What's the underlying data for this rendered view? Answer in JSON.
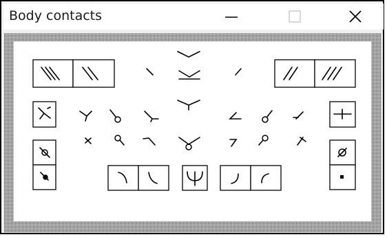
{
  "window": {
    "title": "Body contacts",
    "controls": {
      "minimize": "minimize-icon",
      "maximize": "maximize-icon",
      "close": "close-icon"
    }
  },
  "colors": {
    "frame": "#0a0a0a",
    "titlebar": "#ffffff",
    "client_pattern_dark": "#202020",
    "client_pattern_light": "#cfcfcf",
    "symbol": "#000000"
  },
  "symbol_groups": {
    "top_left_buttons": [
      "three-slash-icon",
      "two-slash-icon"
    ],
    "top_right_buttons": [
      "two-slash-forward-icon",
      "three-slash-forward-icon"
    ],
    "left_column_buttons": [
      "posture-select-icon",
      "open-contact-icon",
      "filled-contact-icon"
    ],
    "right_column_buttons": [
      "horizontal-line-icon",
      "slashed-circle-icon",
      "filled-square-icon"
    ],
    "bottom_buttons": [
      "left-arc-icon",
      "right-arc-icon",
      "trident-icon",
      "left-curve-icon",
      "right-curve-icon"
    ]
  }
}
